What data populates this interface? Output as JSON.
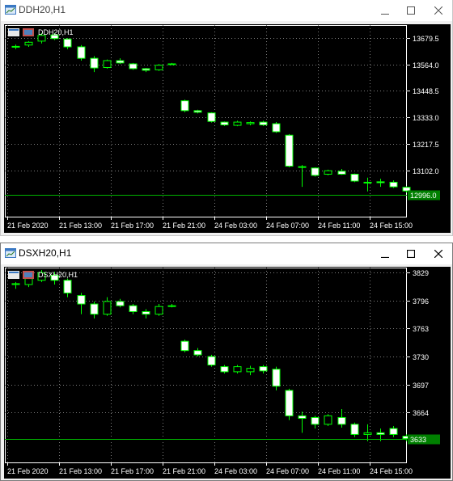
{
  "windows": [
    {
      "title": "DDH20,H1",
      "symbol_label": "DDH20,H1",
      "current_price_label": "12996.0",
      "chart_data": {
        "type": "candlestick",
        "symbol": "DDH20",
        "timeframe": "H1",
        "y_ticks": [
          "13679.5",
          "13564.0",
          "13448.5",
          "13333.0",
          "13217.5",
          "13102.0"
        ],
        "y_tick_values": [
          13679.5,
          13564.0,
          13448.5,
          13333.0,
          13217.5,
          13102.0
        ],
        "ylim": [
          12900,
          13735
        ],
        "current_price": 12996.0,
        "x_ticks": [
          "21 Feb 2020",
          "21 Feb 13:00",
          "21 Feb 17:00",
          "21 Feb 21:00",
          "24 Feb 03:00",
          "24 Feb 07:00",
          "24 Feb 11:00",
          "24 Feb 15:00"
        ],
        "candles": [
          {
            "o": 13640,
            "h": 13650,
            "l": 13630,
            "c": 13642
          },
          {
            "o": 13648,
            "h": 13665,
            "l": 13640,
            "c": 13660
          },
          {
            "o": 13665,
            "h": 13700,
            "l": 13655,
            "c": 13690
          },
          {
            "o": 13692,
            "h": 13700,
            "l": 13670,
            "c": 13676
          },
          {
            "o": 13674,
            "h": 13678,
            "l": 13630,
            "c": 13640
          },
          {
            "o": 13640,
            "h": 13648,
            "l": 13580,
            "c": 13590
          },
          {
            "o": 13590,
            "h": 13600,
            "l": 13530,
            "c": 13548
          },
          {
            "o": 13550,
            "h": 13585,
            "l": 13545,
            "c": 13580
          },
          {
            "o": 13580,
            "h": 13590,
            "l": 13565,
            "c": 13570
          },
          {
            "o": 13566,
            "h": 13570,
            "l": 13540,
            "c": 13545
          },
          {
            "o": 13545,
            "h": 13548,
            "l": 13530,
            "c": 13538
          },
          {
            "o": 13540,
            "h": 13565,
            "l": 13535,
            "c": 13560
          },
          {
            "o": 13563,
            "h": 13570,
            "l": 13562,
            "c": 13566
          },
          {
            "o": 13405,
            "h": 13410,
            "l": 13355,
            "c": 13362
          },
          {
            "o": 13362,
            "h": 13366,
            "l": 13350,
            "c": 13355
          },
          {
            "o": 13352,
            "h": 13355,
            "l": 13310,
            "c": 13315
          },
          {
            "o": 13312,
            "h": 13315,
            "l": 13295,
            "c": 13300
          },
          {
            "o": 13298,
            "h": 13318,
            "l": 13294,
            "c": 13312
          },
          {
            "o": 13305,
            "h": 13315,
            "l": 13298,
            "c": 13310
          },
          {
            "o": 13312,
            "h": 13318,
            "l": 13295,
            "c": 13300
          },
          {
            "o": 13305,
            "h": 13312,
            "l": 13265,
            "c": 13270
          },
          {
            "o": 13255,
            "h": 13260,
            "l": 13115,
            "c": 13120
          },
          {
            "o": 13118,
            "h": 13125,
            "l": 13030,
            "c": 13115
          },
          {
            "o": 13112,
            "h": 13115,
            "l": 13075,
            "c": 13080
          },
          {
            "o": 13085,
            "h": 13105,
            "l": 13080,
            "c": 13100
          },
          {
            "o": 13098,
            "h": 13108,
            "l": 13082,
            "c": 13085
          },
          {
            "o": 13085,
            "h": 13088,
            "l": 13050,
            "c": 13055
          },
          {
            "o": 13050,
            "h": 13070,
            "l": 13010,
            "c": 13050
          },
          {
            "o": 13052,
            "h": 13065,
            "l": 13030,
            "c": 13048
          },
          {
            "o": 13050,
            "h": 13058,
            "l": 13025,
            "c": 13030
          },
          {
            "o": 13028,
            "h": 13032,
            "l": 13005,
            "c": 13012
          }
        ]
      }
    },
    {
      "title": "DSXH20,H1",
      "symbol_label": "DSXH20,H1",
      "current_price_label": "3633",
      "chart_data": {
        "type": "candlestick",
        "symbol": "DSXH20",
        "timeframe": "H1",
        "y_ticks": [
          "3829",
          "3796",
          "3763",
          "3730",
          "3697",
          "3664"
        ],
        "y_tick_values": [
          3829,
          3796,
          3763,
          3730,
          3697,
          3664
        ],
        "ylim": [
          3605,
          3835
        ],
        "current_price": 3633,
        "x_ticks": [
          "21 Feb 2020",
          "21 Feb 13:00",
          "21 Feb 17:00",
          "21 Feb 21:00",
          "24 Feb 03:00",
          "24 Feb 07:00",
          "24 Feb 11:00",
          "24 Feb 15:00"
        ],
        "candles": [
          {
            "o": 3815,
            "h": 3818,
            "l": 3810,
            "c": 3816
          },
          {
            "o": 3815,
            "h": 3825,
            "l": 3812,
            "c": 3822
          },
          {
            "o": 3820,
            "h": 3832,
            "l": 3818,
            "c": 3829
          },
          {
            "o": 3826,
            "h": 3830,
            "l": 3815,
            "c": 3820
          },
          {
            "o": 3820,
            "h": 3822,
            "l": 3800,
            "c": 3805
          },
          {
            "o": 3802,
            "h": 3805,
            "l": 3780,
            "c": 3792
          },
          {
            "o": 3792,
            "h": 3795,
            "l": 3775,
            "c": 3780
          },
          {
            "o": 3780,
            "h": 3800,
            "l": 3778,
            "c": 3795
          },
          {
            "o": 3795,
            "h": 3798,
            "l": 3788,
            "c": 3790
          },
          {
            "o": 3790,
            "h": 3792,
            "l": 3780,
            "c": 3783
          },
          {
            "o": 3783,
            "h": 3786,
            "l": 3775,
            "c": 3780
          },
          {
            "o": 3780,
            "h": 3792,
            "l": 3778,
            "c": 3789
          },
          {
            "o": 3789,
            "h": 3792,
            "l": 3788,
            "c": 3790
          },
          {
            "o": 3748,
            "h": 3750,
            "l": 3735,
            "c": 3737
          },
          {
            "o": 3737,
            "h": 3740,
            "l": 3730,
            "c": 3732
          },
          {
            "o": 3730,
            "h": 3732,
            "l": 3718,
            "c": 3720
          },
          {
            "o": 3718,
            "h": 3720,
            "l": 3710,
            "c": 3712
          },
          {
            "o": 3712,
            "h": 3720,
            "l": 3710,
            "c": 3718
          },
          {
            "o": 3712,
            "h": 3719,
            "l": 3708,
            "c": 3716
          },
          {
            "o": 3718,
            "h": 3720,
            "l": 3710,
            "c": 3713
          },
          {
            "o": 3715,
            "h": 3718,
            "l": 3690,
            "c": 3695
          },
          {
            "o": 3690,
            "h": 3692,
            "l": 3655,
            "c": 3660
          },
          {
            "o": 3660,
            "h": 3665,
            "l": 3640,
            "c": 3657
          },
          {
            "o": 3658,
            "h": 3660,
            "l": 3645,
            "c": 3650
          },
          {
            "o": 3650,
            "h": 3662,
            "l": 3648,
            "c": 3660
          },
          {
            "o": 3658,
            "h": 3668,
            "l": 3646,
            "c": 3650
          },
          {
            "o": 3650,
            "h": 3652,
            "l": 3635,
            "c": 3638
          },
          {
            "o": 3638,
            "h": 3650,
            "l": 3630,
            "c": 3640
          },
          {
            "o": 3640,
            "h": 3645,
            "l": 3630,
            "c": 3638
          },
          {
            "o": 3645,
            "h": 3648,
            "l": 3635,
            "c": 3638
          },
          {
            "o": 3636,
            "h": 3638,
            "l": 3630,
            "c": 3633
          }
        ]
      }
    }
  ]
}
